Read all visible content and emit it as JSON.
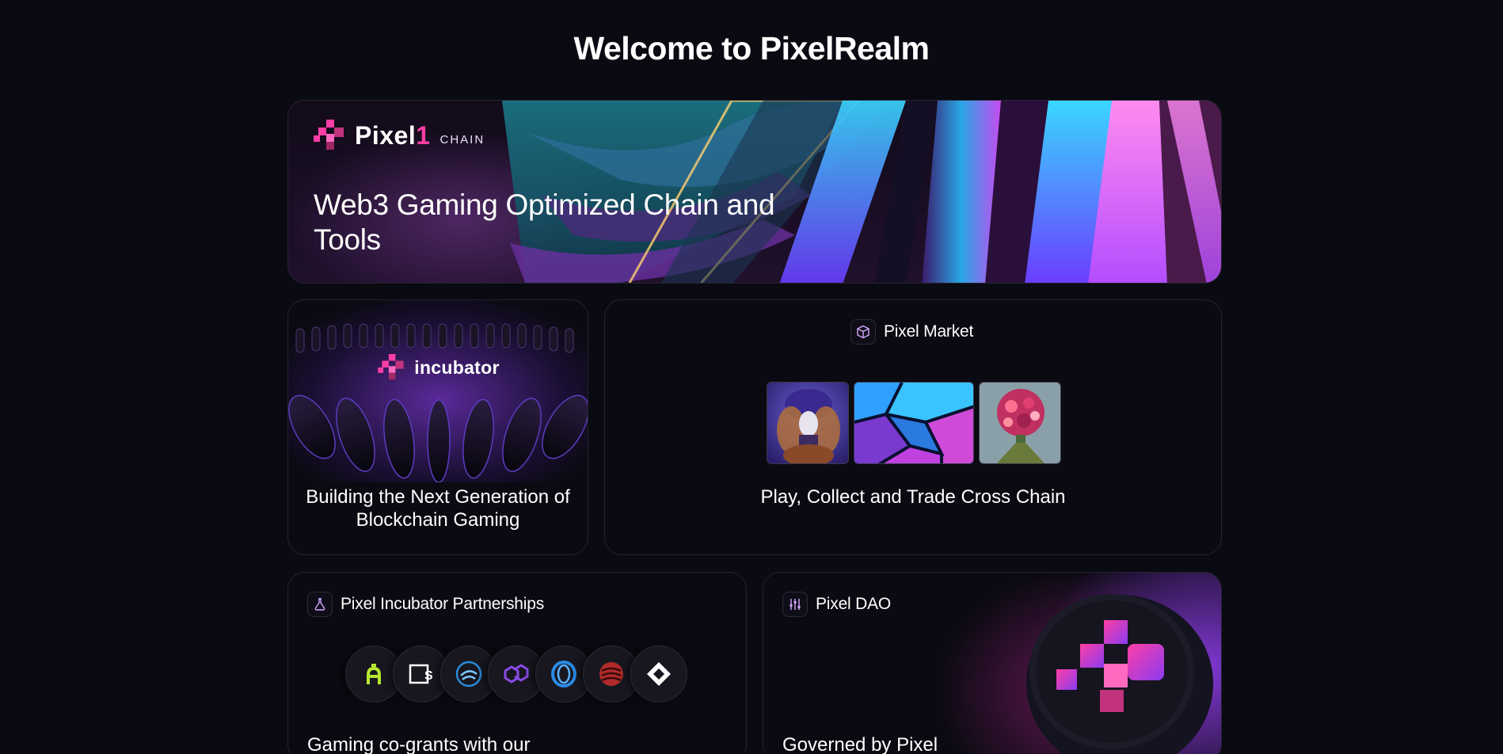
{
  "page": {
    "title": "Welcome to PixelRealm"
  },
  "hero": {
    "logo_word": "Pixel",
    "logo_mark": "1",
    "logo_sub": "CHAIN",
    "headline": "Web3 Gaming Optimized Chain and Tools"
  },
  "incubator": {
    "logo_word": "incubator",
    "caption": "Building the Next Generation of Blockchain Gaming"
  },
  "market": {
    "title": "Pixel Market",
    "icon": "cube-icon",
    "caption": "Play, Collect and Trade Cross Chain",
    "thumbnails": [
      "ornate-portrait-nft",
      "crystal-shards-nft",
      "flower-head-nft"
    ]
  },
  "partnerships": {
    "title": "Pixel Incubator Partnerships",
    "icon": "flask-icon",
    "partners": [
      "aavegotchi-logo",
      "wallet-s-logo",
      "swan-logo",
      "polygon-logo",
      "ring-logo",
      "red-swirl-logo",
      "diamond-logo"
    ],
    "bottom_text": "Gaming co-grants with our"
  },
  "dao": {
    "title": "Pixel DAO",
    "icon": "sliders-icon",
    "bottom_text": "Governed by Pixel"
  },
  "colors": {
    "background": "#0a0a12",
    "accent_pink": "#ff3ea5",
    "accent_purple": "#8a3cf0"
  }
}
